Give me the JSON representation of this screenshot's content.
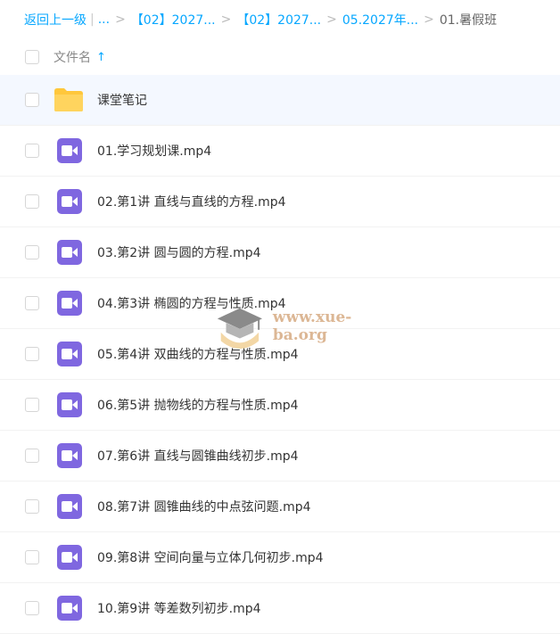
{
  "breadcrumb": {
    "back_label": "返回上一级",
    "ellipsis": "...",
    "items": [
      "【02】2027...",
      "【02】2027...",
      "05.2027年..."
    ],
    "current": "01.暑假班"
  },
  "header": {
    "name_label": "文件名",
    "sort_arrow": "↑"
  },
  "files": [
    {
      "name": "课堂笔记",
      "type": "folder"
    },
    {
      "name": "01.学习规划课.mp4",
      "type": "video"
    },
    {
      "name": "02.第1讲 直线与直线的方程.mp4",
      "type": "video"
    },
    {
      "name": "03.第2讲 圆与圆的方程.mp4",
      "type": "video"
    },
    {
      "name": "04.第3讲 椭圆的方程与性质.mp4",
      "type": "video"
    },
    {
      "name": "05.第4讲 双曲线的方程与性质.mp4",
      "type": "video"
    },
    {
      "name": "06.第5讲 抛物线的方程与性质.mp4",
      "type": "video"
    },
    {
      "name": "07.第6讲 直线与圆锥曲线初步.mp4",
      "type": "video"
    },
    {
      "name": "08.第7讲 圆锥曲线的中点弦问题.mp4",
      "type": "video"
    },
    {
      "name": "09.第8讲 空间向量与立体几何初步.mp4",
      "type": "video"
    },
    {
      "name": "10.第9讲 等差数列初步.mp4",
      "type": "video"
    }
  ],
  "watermark": {
    "text": "www.xue-ba.org"
  },
  "colors": {
    "accent": "#06a7ff",
    "video_icon": "#7f67e0",
    "folder": "#ffc73b"
  },
  "icons": {
    "folder": "folder-icon",
    "video": "video-file-icon",
    "sort": "sort-ascending-icon"
  }
}
